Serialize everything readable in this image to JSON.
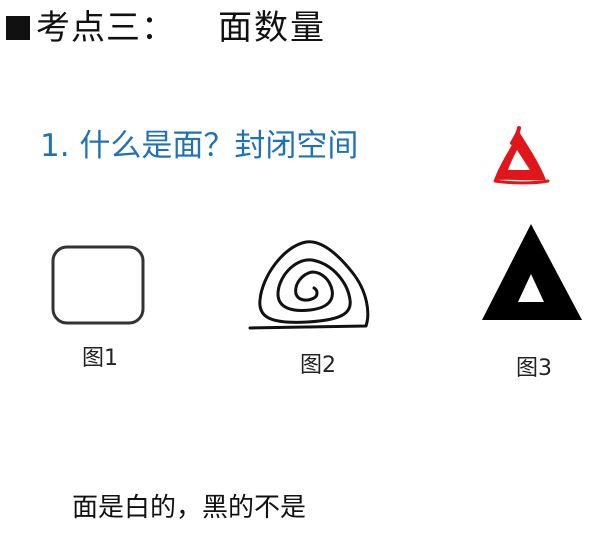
{
  "slide": {
    "title_prefix": "考点三：",
    "title_main": "面数量",
    "question": "1. 什么是面？封闭空间",
    "figures": [
      {
        "caption": "图1",
        "shape_icon": "rounded-square-icon"
      },
      {
        "caption": "图2",
        "shape_icon": "spiral-icon"
      },
      {
        "caption": "图3",
        "shape_icon": "hollow-triangle-icon"
      }
    ],
    "annotation_icon": "red-triangle-mark-icon",
    "note": "面是白的，黑的不是"
  },
  "colors": {
    "question_text": "#1f72b8",
    "annotation_red": "#e0161b",
    "text": "#111111"
  }
}
